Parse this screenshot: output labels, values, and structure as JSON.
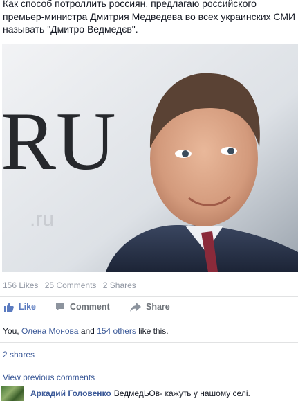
{
  "post": {
    "text": "Как способ потроллить россиян, предлагаю российского премьер-министра Дмитрия Медведева во всех украинских СМИ называть \"Дмитро Ведмедєв\".",
    "photo": {
      "background_text": "RU"
    }
  },
  "stats": {
    "likes": "156 Likes",
    "comments": "25 Comments",
    "shares": "2 Shares"
  },
  "actions": {
    "like": "Like",
    "comment": "Comment",
    "share": "Share"
  },
  "likes_summary": {
    "you": "You,",
    "friend": "Олена Монова",
    "and": "and",
    "others": "154 others",
    "tail": "like this."
  },
  "shares_link": "2 shares",
  "view_previous": "View previous comments",
  "comment": {
    "author": "Аркадий Головенко",
    "text": "ВедмедЬОв- кажуть у нашому селі."
  },
  "colors": {
    "link": "#3b5998",
    "like_active": "#5b7bc0",
    "muted": "#9197a3",
    "divider": "#e1e2e3"
  },
  "icons": {
    "like": "thumbs-up-icon",
    "comment": "speech-bubble-icon",
    "share": "share-arrow-icon"
  }
}
